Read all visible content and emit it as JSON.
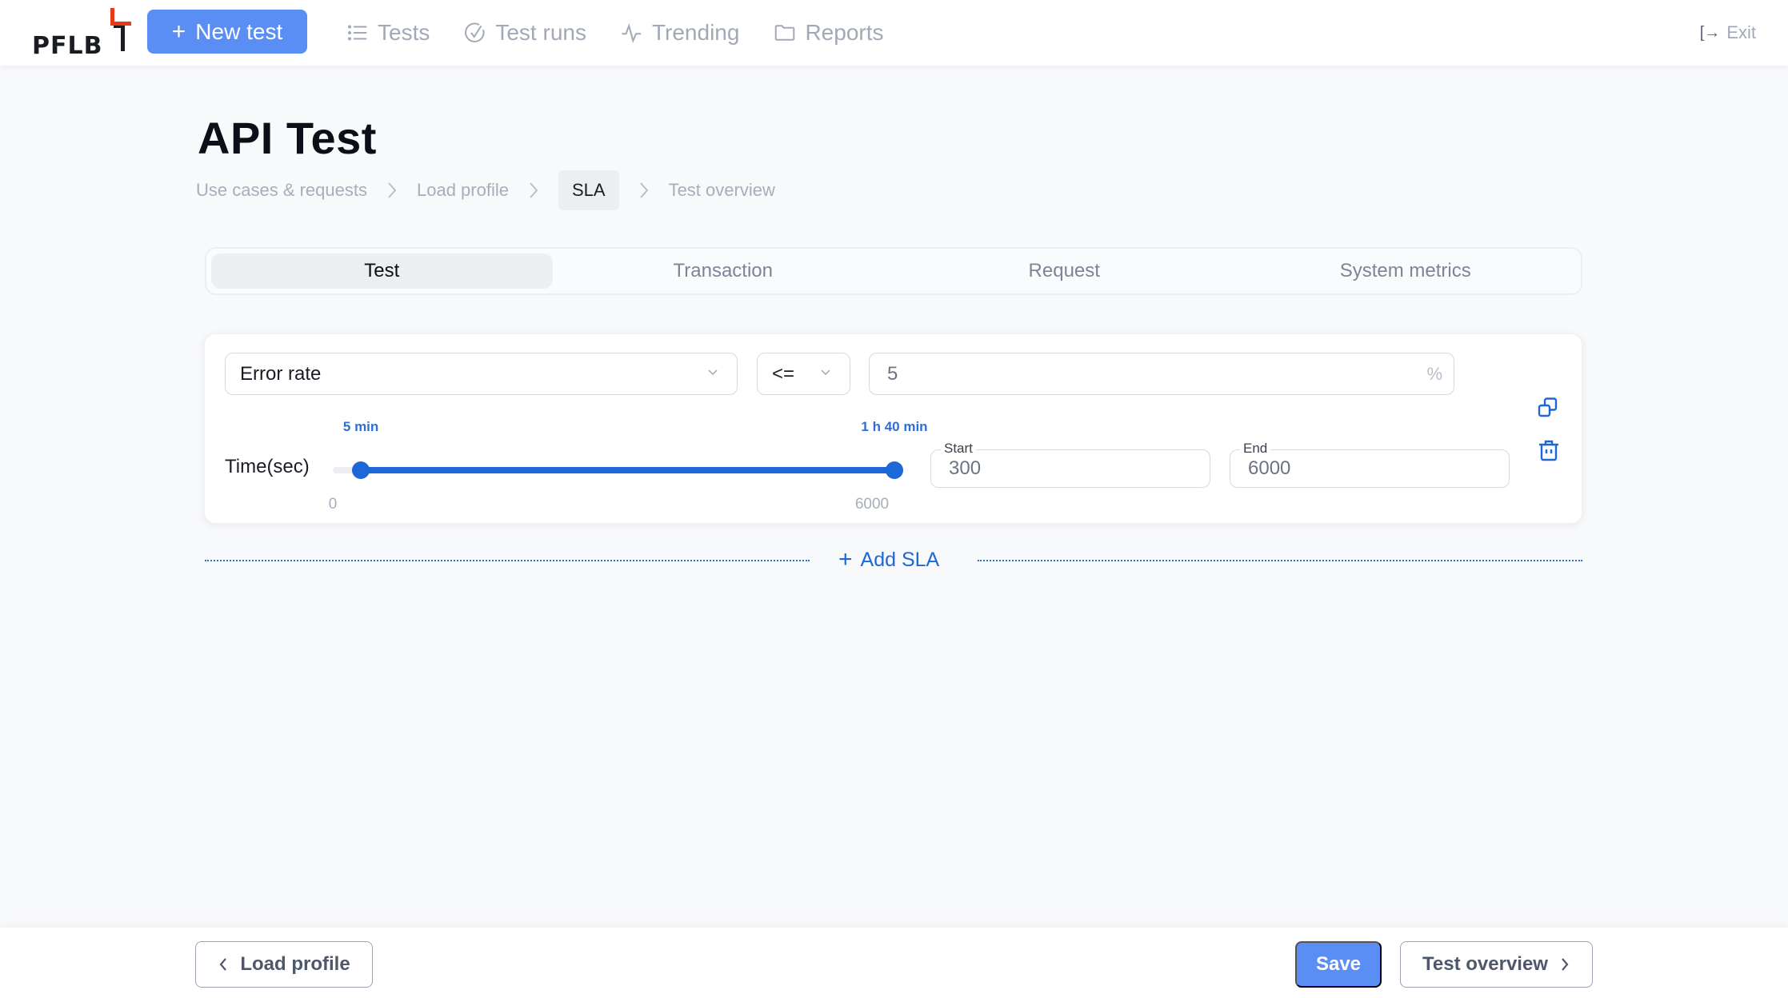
{
  "header": {
    "logo_text": "PFLB",
    "new_test_label": "New test",
    "nav": [
      {
        "label": "Tests",
        "icon": "list-icon"
      },
      {
        "label": "Test runs",
        "icon": "check-circle-icon"
      },
      {
        "label": "Trending",
        "icon": "pulse-icon"
      },
      {
        "label": "Reports",
        "icon": "folder-icon"
      }
    ],
    "exit_label": "Exit"
  },
  "page": {
    "title": "API Test",
    "breadcrumbs": [
      {
        "label": "Use cases & requests",
        "active": false
      },
      {
        "label": "Load profile",
        "active": false
      },
      {
        "label": "SLA",
        "active": true
      },
      {
        "label": "Test overview",
        "active": false
      }
    ]
  },
  "tabs": [
    {
      "label": "Test",
      "active": true
    },
    {
      "label": "Transaction",
      "active": false
    },
    {
      "label": "Request",
      "active": false
    },
    {
      "label": "System metrics",
      "active": false
    }
  ],
  "sla": {
    "metric": "Error rate",
    "operator": "<=",
    "value": "5",
    "unit": "%",
    "time_label": "Time(sec)",
    "slider": {
      "min": 0,
      "max": 6000,
      "start": 300,
      "end": 6000,
      "min_label": "0",
      "max_label": "6000",
      "start_label": "5 min",
      "end_label": "1 h 40 min"
    },
    "start_field": {
      "legend": "Start",
      "value": "300"
    },
    "end_field": {
      "legend": "End",
      "value": "6000"
    }
  },
  "add_sla_label": "Add SLA",
  "footer": {
    "back_label": "Load profile",
    "save_label": "Save",
    "next_label": "Test overview"
  },
  "colors": {
    "primary": "#5b8ef5",
    "accent_blue": "#1d67d8",
    "logo_red": "#e8391d"
  }
}
